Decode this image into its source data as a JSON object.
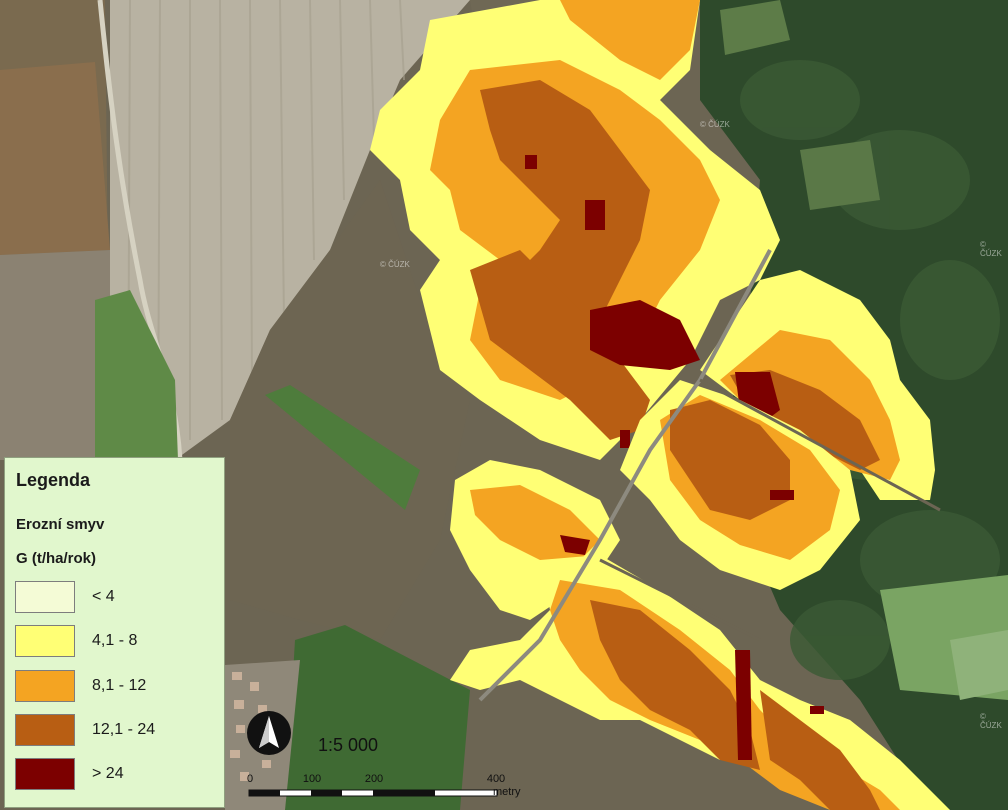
{
  "legend": {
    "title": "Legenda",
    "subtitle": "Erozní smyv",
    "unit": "G (t/ha/rok)",
    "items": [
      {
        "label": "< 4",
        "color": "#f4fbd6"
      },
      {
        "label": "4,1 - 8",
        "color": "#ffff75"
      },
      {
        "label": "8,1 - 12",
        "color": "#f4a422"
      },
      {
        "label": "12,1 - 24",
        "color": "#b85e13"
      },
      {
        "label": "> 24",
        "color": "#7c0000"
      }
    ]
  },
  "scale": {
    "ratio": "1:5 000",
    "ticks": [
      "0",
      "100",
      "200",
      "400"
    ],
    "unit": "metry"
  },
  "watermark": "© ČÚZK",
  "colors": {
    "field_light": "#b6b09f",
    "field_dark": "#6b6452",
    "forest": "#2f4a2c",
    "grass": "#4f7a3e"
  }
}
